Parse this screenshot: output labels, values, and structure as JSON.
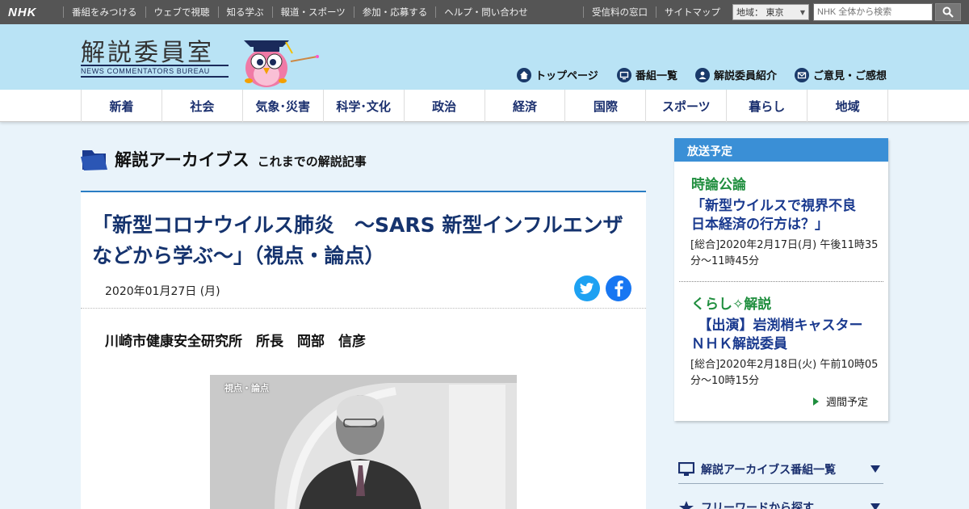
{
  "topbar": {
    "logo": "NHK",
    "links": [
      "番組をみつける",
      "ウェブで視聴",
      "知る学ぶ",
      "報道・スポーツ",
      "参加・応募する",
      "ヘルプ・問い合わせ"
    ],
    "right_links": [
      "受信料の窓口",
      "サイトマップ"
    ],
    "region_label": "地域： 東京",
    "search_placeholder": "NHK 全体から検索"
  },
  "header": {
    "site_title": "解説委員室",
    "site_subtitle": "NEWS COMMENTATORS BUREAU",
    "nav": [
      "トップページ",
      "番組一覧",
      "解説委員紹介",
      "ご意見・ご感想"
    ]
  },
  "categories": [
    "新着",
    "社会",
    "気象･災害",
    "科学･文化",
    "政治",
    "経済",
    "国際",
    "スポーツ",
    "暮らし",
    "地域"
  ],
  "archive": {
    "title": "解説アーカイブス",
    "subtitle": "これまでの解説記事"
  },
  "article": {
    "title": "「新型コロナウイルス肺炎　～SARS 新型インフルエンザなどから学ぶ～」（視点・論点）",
    "date": "2020年01月27日 (月)",
    "author": "川崎市健康安全研究所　所長　岡部　信彦",
    "photo_caption": "視点・論点"
  },
  "schedule": {
    "heading": "放送予定",
    "items": [
      {
        "program": "時論公論",
        "title": "「新型ウイルスで視界不良　日本経済の行方は？」",
        "time": "[総合]2020年2月17日(月) 午後11時35分～11時45分"
      },
      {
        "program": "くらし✧解説",
        "title": "　【出演】岩渕梢キャスター　ＮＨＫ解説委員",
        "time": "[総合]2020年2月18日(火) 午前10時05分～10時15分"
      }
    ],
    "weekly_link": "週間予定"
  },
  "side_menu": [
    "解説アーカイブス番組一覧",
    "フリーワードから探す"
  ],
  "colors": {
    "topbar": "#555555",
    "header": "#b9e3f5",
    "accent_blue": "#2a7dc4",
    "title_navy": "#15336e",
    "program_green": "#1f8e3e"
  }
}
